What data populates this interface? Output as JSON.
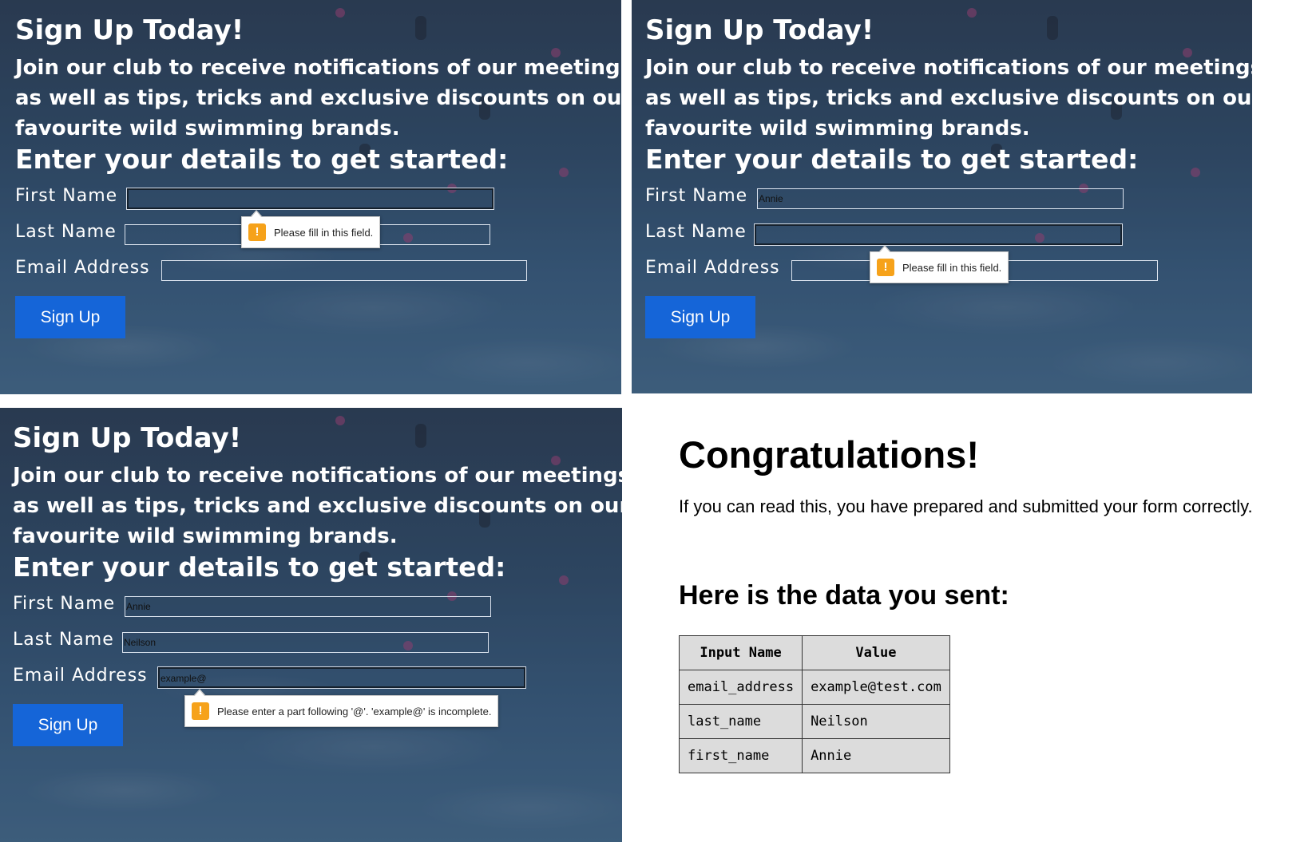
{
  "form": {
    "title": "Sign Up Today!",
    "intro": "Join our club to receive notifications of our meetings as well as tips, tricks and exclusive discounts on our favourite wild swimming brands.",
    "subtitle": "Enter your details to get started:",
    "labels": {
      "first_name": "First Name",
      "last_name": "Last Name",
      "email": "Email Address"
    },
    "button_label": "Sign Up",
    "warning_icon": "warning-icon"
  },
  "panels": [
    {
      "first_name": "",
      "last_name": "",
      "email": "",
      "tooltip": "Please fill in this field."
    },
    {
      "first_name": "Annie",
      "last_name": "",
      "email": "",
      "tooltip": "Please fill in this field."
    },
    {
      "first_name": "Annie",
      "last_name": "Neilson",
      "email": "example@",
      "tooltip": "Please enter a part following '@'. 'example@' is incomplete."
    }
  ],
  "result": {
    "title": "Congratulations!",
    "message": "If you can read this, you have prepared and submitted your form correctly.",
    "subtitle": "Here is the data you sent:",
    "table": {
      "headers": [
        "Input Name",
        "Value"
      ],
      "rows": [
        [
          "email_address",
          "example@test.com"
        ],
        [
          "last_name",
          "Neilson"
        ],
        [
          "first_name",
          "Annie"
        ]
      ]
    }
  },
  "colors": {
    "button": "#1565d8",
    "warning": "#f6a21a",
    "overlay": "#2f4460"
  }
}
